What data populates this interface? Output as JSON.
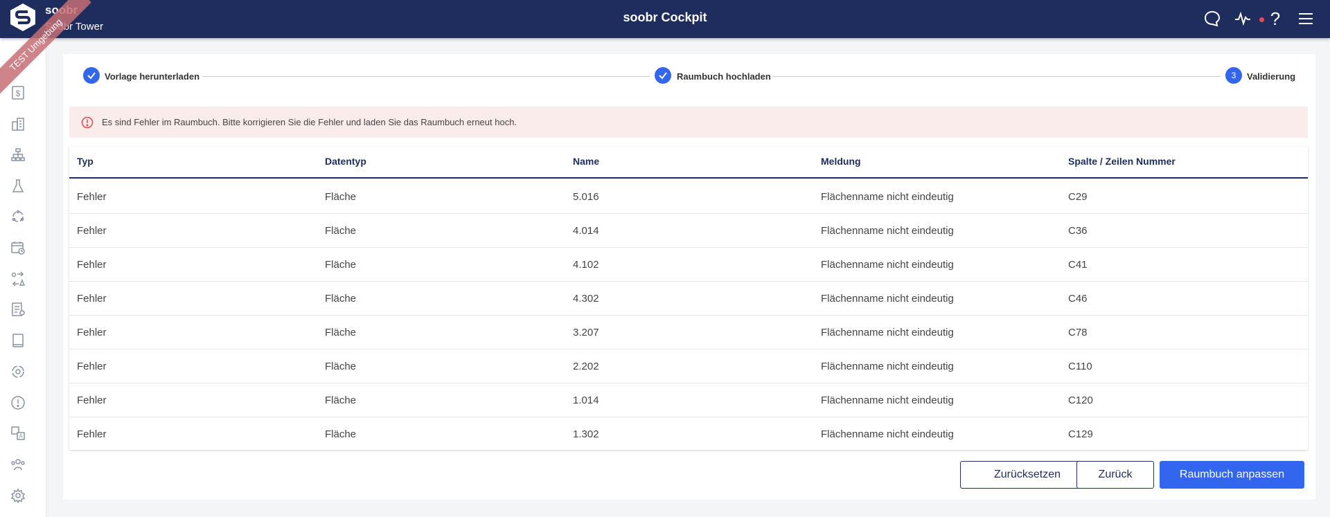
{
  "app": {
    "brand_name": "soobr",
    "brand_sub": "Soobr Tower",
    "title": "soobr Cockpit",
    "env_ribbon": "TEST Umgebung"
  },
  "header_icons": [
    "chat-icon",
    "activity-icon",
    "help-icon",
    "menu-icon"
  ],
  "sidebar_icons": [
    "dashboard-icon",
    "billing-icon",
    "buildings-icon",
    "hierarchy-icon",
    "lab-icon",
    "cycle-icon",
    "calendar-icon",
    "assignment-icon",
    "report-icon",
    "book-icon",
    "target-icon",
    "alert-icon",
    "translate-icon",
    "team-icon",
    "settings-icon"
  ],
  "stepper": {
    "steps": [
      {
        "label": "Vorlage herunterladen",
        "state": "done"
      },
      {
        "label": "Raumbuch hochladen",
        "state": "done"
      },
      {
        "label": "Validierung",
        "state": "active",
        "number": "3"
      }
    ]
  },
  "banner": {
    "text": "Es sind Fehler im Raumbuch. Bitte korrigieren Sie die Fehler und laden Sie das Raumbuch erneut hoch."
  },
  "table": {
    "headers": [
      "Typ",
      "Datentyp",
      "Name",
      "Meldung",
      "Spalte / Zeilen Nummer"
    ],
    "rows": [
      [
        "Fehler",
        "Fläche",
        "5.016",
        "Flächenname nicht eindeutig",
        "C29"
      ],
      [
        "Fehler",
        "Fläche",
        "4.014",
        "Flächenname nicht eindeutig",
        "C36"
      ],
      [
        "Fehler",
        "Fläche",
        "4.102",
        "Flächenname nicht eindeutig",
        "C41"
      ],
      [
        "Fehler",
        "Fläche",
        "4.302",
        "Flächenname nicht eindeutig",
        "C46"
      ],
      [
        "Fehler",
        "Fläche",
        "3.207",
        "Flächenname nicht eindeutig",
        "C78"
      ],
      [
        "Fehler",
        "Fläche",
        "2.202",
        "Flächenname nicht eindeutig",
        "C110"
      ],
      [
        "Fehler",
        "Fläche",
        "1.014",
        "Flächenname nicht eindeutig",
        "C120"
      ],
      [
        "Fehler",
        "Fläche",
        "1.302",
        "Flächenname nicht eindeutig",
        "C129"
      ]
    ]
  },
  "buttons": {
    "reset": "Zurücksetzen",
    "back": "Zurück",
    "primary": "Raumbuch anpassen"
  },
  "colors": {
    "header_bg": "#1e2d5e",
    "accent": "#3366ee",
    "error": "#e8494b",
    "banner_bg": "#fbecec"
  }
}
